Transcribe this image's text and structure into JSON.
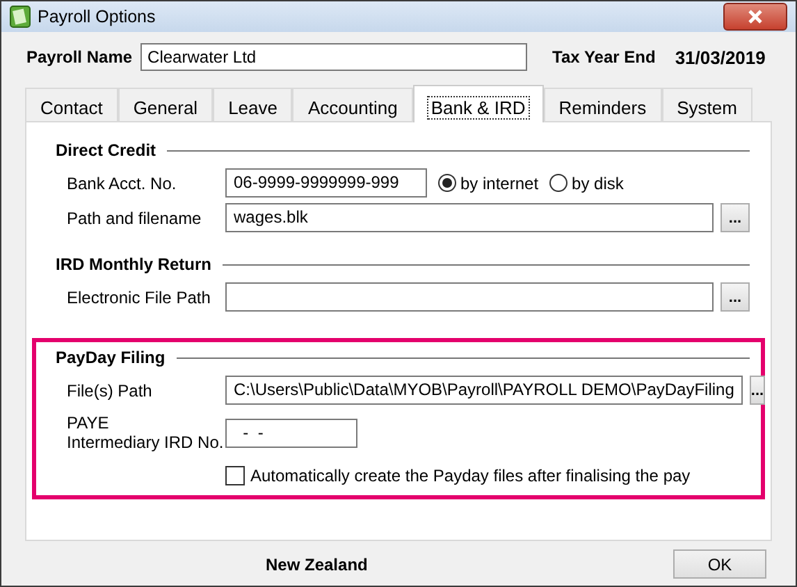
{
  "window": {
    "title": "Payroll Options"
  },
  "header": {
    "payroll_name_label": "Payroll Name",
    "payroll_name": "Clearwater Ltd",
    "tax_year_end_label": "Tax Year End",
    "tax_year_end": "31/03/2019"
  },
  "tabs": [
    {
      "label": "Contact",
      "selected": false
    },
    {
      "label": "General",
      "selected": false
    },
    {
      "label": "Leave",
      "selected": false
    },
    {
      "label": "Accounting",
      "selected": false
    },
    {
      "label": "Bank & IRD",
      "selected": true
    },
    {
      "label": "Reminders",
      "selected": false
    },
    {
      "label": "System",
      "selected": false
    }
  ],
  "sections": [
    {
      "title": "Direct Credit",
      "highlighted": false,
      "rows": [
        {
          "kind": "field",
          "label": "Bank Acct. No.",
          "value": "06-9999-9999999-999",
          "radios": [
            {
              "label": "by internet",
              "selected": true
            },
            {
              "label": "by disk",
              "selected": false
            }
          ]
        },
        {
          "kind": "path",
          "label": "Path and filename",
          "value": "wages.blk",
          "browse": "..."
        }
      ]
    },
    {
      "title": "IRD Monthly Return",
      "highlighted": false,
      "rows": [
        {
          "kind": "path",
          "label": "Electronic File Path",
          "browse": "..."
        }
      ]
    },
    {
      "title": "PayDay Filing",
      "highlighted": true,
      "rows": [
        {
          "kind": "path",
          "label": "File(s) Path",
          "value": "C:\\Users\\Public\\Data\\MYOB\\Payroll\\PAYROLL DEMO\\PayDayFiling",
          "browse": "..."
        },
        {
          "kind": "field",
          "label": "PAYE\nIntermediary IRD No.",
          "value": "  -  -"
        },
        {
          "kind": "checkbox",
          "label": "Automatically create the Payday files after finalising the pay",
          "checked": false
        }
      ]
    }
  ],
  "footer": {
    "country": "New Zealand",
    "ok_button": "OK"
  }
}
